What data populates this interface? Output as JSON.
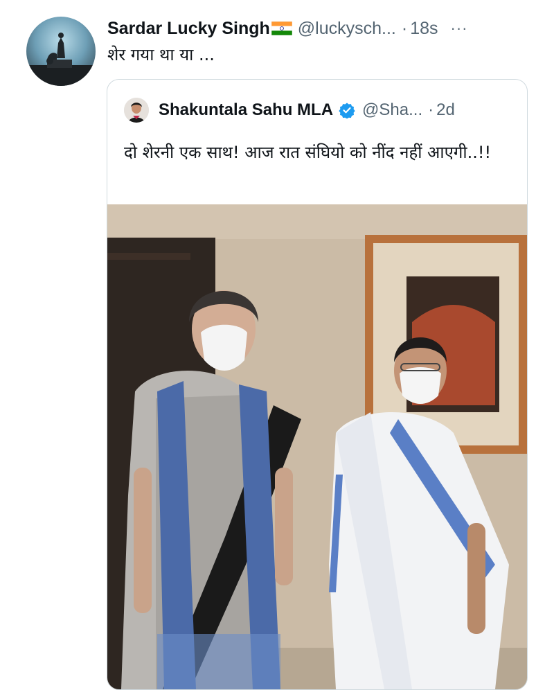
{
  "tweet": {
    "display_name": "Sardar Lucky Singh",
    "handle": "@luckysch...",
    "separator": "·",
    "time": "18s",
    "more": "···",
    "text": "शेर गया था या ...",
    "avatar_icon": "profile-avatar-silhouette",
    "flag_icon": "india-flag-icon"
  },
  "quote": {
    "display_name": "Shakuntala Sahu MLA",
    "handle": "@Sha...",
    "separator": "·",
    "time": "2d",
    "text": "दो शेरनी एक साथ! आज रात संघियो को नींद नहीं आएगी..!!",
    "verified_icon": "verified-badge-icon",
    "verified_color": "#1d9bf0",
    "photo_description_icon": "tweet-photo"
  },
  "colors": {
    "text_primary": "#0f1419",
    "text_secondary": "#536471",
    "border": "#cfd9de"
  }
}
